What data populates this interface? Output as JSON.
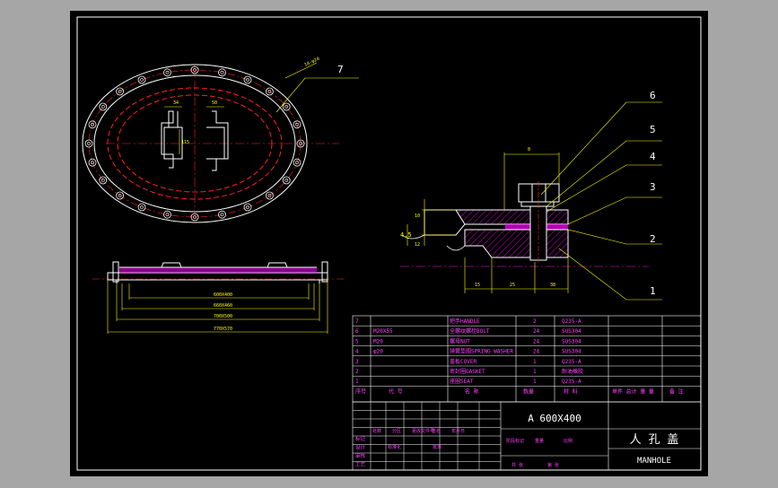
{
  "drawing": {
    "balloons": [
      "7",
      "6",
      "5",
      "4",
      "3",
      "2",
      "1"
    ],
    "plan_dims": [
      "14-φ24",
      "50",
      "34",
      "115"
    ],
    "section_dims": [
      "4.5",
      "10",
      "12",
      "8",
      "15",
      "25",
      "38"
    ],
    "elevation_dims": [
      "600X400",
      "660X460",
      "700X500",
      "770X570"
    ]
  },
  "parts_list": {
    "header": [
      "序号",
      "代  号",
      "名  称",
      "数量",
      "材  料",
      "单件 总计 重 量",
      "备  注"
    ],
    "rows": [
      {
        "no": "7",
        "code": "",
        "name": "把手HANDLE",
        "qty": "2",
        "material": "Q235-A"
      },
      {
        "no": "6",
        "code": "M20X55",
        "name": "全螺纹螺栓BOLT",
        "qty": "24",
        "material": "SUS304"
      },
      {
        "no": "5",
        "code": "M20",
        "name": "螺母NUT",
        "qty": "24",
        "material": "SUS304"
      },
      {
        "no": "4",
        "code": "φ20",
        "name": "弹簧垫圈SPRING WASHER",
        "qty": "24",
        "material": "SUS304"
      },
      {
        "no": "3",
        "code": "",
        "name": "盖板COVER",
        "qty": "1",
        "material": "Q235-A"
      },
      {
        "no": "2",
        "code": "",
        "name": "密封圈GASKET",
        "qty": "1",
        "material": "耐油橡胶"
      },
      {
        "no": "1",
        "code": "",
        "name": "座圈SEAT",
        "qty": "1",
        "material": "Q235-A"
      }
    ]
  },
  "title_block": {
    "spec": "A 600X400",
    "title_cn": "人 孔 盖",
    "title_en": "MANHOLE",
    "left_labels": [
      "标记",
      "设计",
      "审核",
      "工艺"
    ],
    "grid_labels": [
      "处数",
      "分区",
      "更改文件号",
      "签名",
      "年月日",
      "标准化",
      "批准",
      "阶段标记",
      "重量",
      "比例",
      "共 张",
      "第 张"
    ]
  },
  "colors": {
    "frame": "#ffffff",
    "geometry": "#ffffff",
    "centerline": "#ff2020",
    "dimension": "#ffff00",
    "hatch": "#ff00ff",
    "pink_text": "#ff40ff",
    "background": "#000000",
    "outer_bg": "#a6a6a6"
  }
}
